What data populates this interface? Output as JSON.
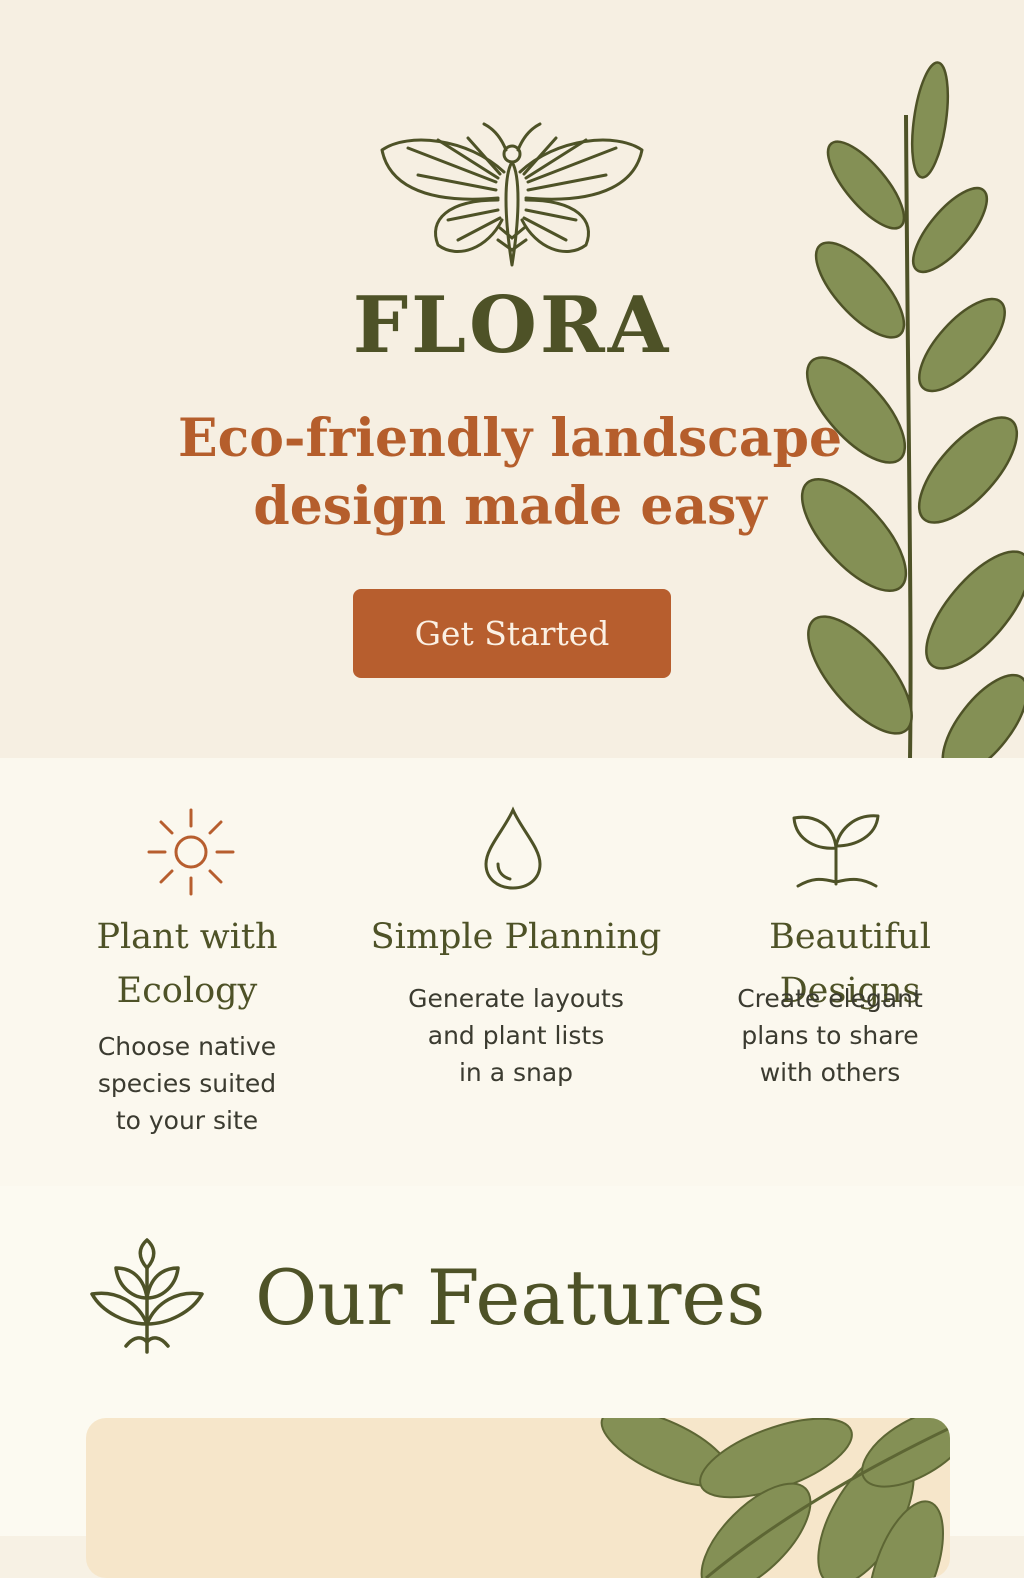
{
  "brand": {
    "name": "FLORA",
    "logo_icon": "moth-icon"
  },
  "hero": {
    "tagline_line1": "Eco-friendly landscape",
    "tagline_line2": "design made easy",
    "cta_label": "Get Started",
    "decor_icon": "leafy-branch-icon"
  },
  "benefits": [
    {
      "icon": "sun-icon",
      "title_line1": "Plant with",
      "title_line2": "Ecology",
      "desc_line1": "Choose native",
      "desc_line2": "species suited",
      "desc_line3": "to your site"
    },
    {
      "icon": "water-drop-icon",
      "title_line1": "Simple Planning",
      "desc_line1": "Generate layouts",
      "desc_line2": "and plant lists",
      "desc_line3": "in a snap"
    },
    {
      "icon": "sprout-icon",
      "title_line1": "Beautiful Designs",
      "desc_line1": "Create elegant",
      "desc_line2": "plans to share",
      "desc_line3": "with others"
    }
  ],
  "features": {
    "title": "Our Features",
    "icon": "plant-icon"
  },
  "colors": {
    "olive": "#4e5227",
    "terracotta": "#b75e2e",
    "cream": "#f6efe2",
    "leaf": "#849055"
  }
}
